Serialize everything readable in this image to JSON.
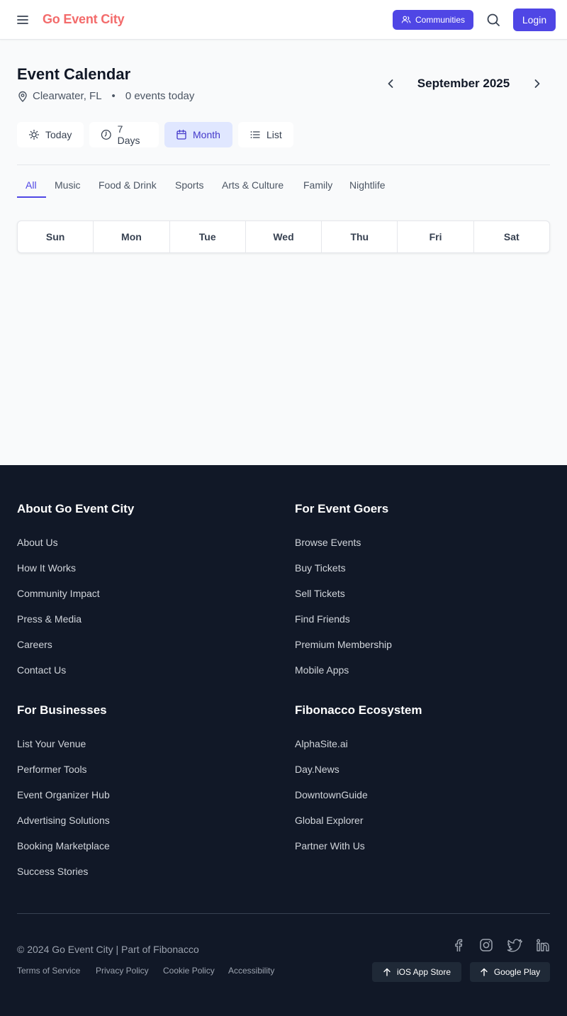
{
  "header": {
    "brand": "Go Event City",
    "communities_label": "Communities",
    "login_label": "Login",
    "brand_color": "#f36b6b",
    "accent_color": "#4f46e5"
  },
  "calendar": {
    "title": "Event Calendar",
    "location": "Clearwater, FL",
    "separator": "•",
    "events_today": "0 events today",
    "month_label": "September 2025",
    "view_tabs": [
      {
        "label": "Today",
        "icon": "sun-icon"
      },
      {
        "label": "7 Days",
        "icon": "clock-icon"
      },
      {
        "label": "Month",
        "icon": "calendar-icon",
        "active": true
      },
      {
        "label": "List",
        "icon": "list-icon"
      }
    ],
    "categories": [
      "All",
      "Music",
      "Food & Drink",
      "Sports",
      "Arts & Culture",
      "Family",
      "Nightlife"
    ],
    "active_category": "All",
    "weekdays": [
      "Sun",
      "Mon",
      "Tue",
      "Wed",
      "Thu",
      "Fri",
      "Sat"
    ]
  },
  "footer": {
    "sections": [
      {
        "title": "About Go Event City",
        "links": [
          "About Us",
          "How It Works",
          "Community Impact",
          "Press & Media",
          "Careers",
          "Contact Us"
        ]
      },
      {
        "title": "For Event Goers",
        "links": [
          "Browse Events",
          "Buy Tickets",
          "Sell Tickets",
          "Find Friends",
          "Premium Membership",
          "Mobile Apps"
        ]
      },
      {
        "title": "For Businesses",
        "links": [
          "List Your Venue",
          "Performer Tools",
          "Event Organizer Hub",
          "Advertising Solutions",
          "Booking Marketplace",
          "Success Stories"
        ]
      },
      {
        "title": "Fibonacco Ecosystem",
        "links": [
          "AlphaSite.ai",
          "Day.News",
          "DowntownGuide",
          "Global Explorer",
          "Partner With Us"
        ]
      }
    ],
    "copyright": "© 2024 Go Event City | Part of Fibonacco",
    "legal_links": [
      "Terms of Service",
      "Privacy Policy",
      "Cookie Policy",
      "Accessibility"
    ],
    "social_icons": [
      "facebook-icon",
      "instagram-icon",
      "twitter-icon",
      "linkedin-icon"
    ],
    "app_buttons": [
      "iOS App Store",
      "Google Play"
    ]
  }
}
